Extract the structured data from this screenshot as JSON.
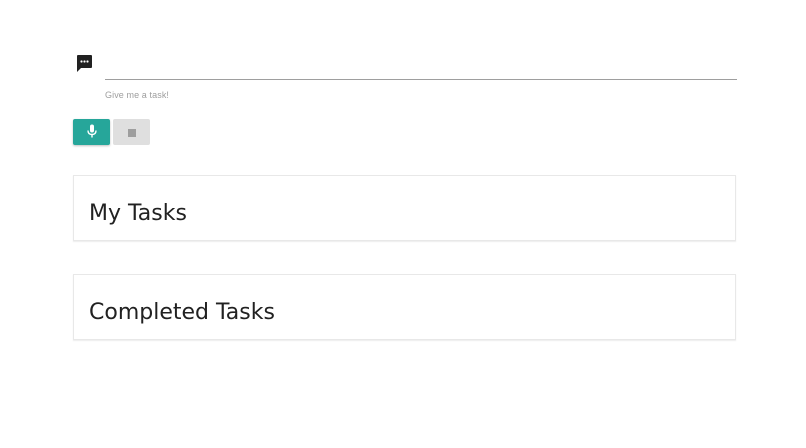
{
  "task_input": {
    "icon": "chat-bubble-icon",
    "value": "",
    "helper_text": "Give me a task!"
  },
  "controls": {
    "mic_button_icon": "microphone-icon",
    "stop_button_icon": "stop-icon",
    "mic_button_color": "#26a69a",
    "stop_button_color": "#dfdfdf"
  },
  "sections": {
    "my_tasks_title": "My Tasks",
    "completed_tasks_title": "Completed Tasks"
  }
}
